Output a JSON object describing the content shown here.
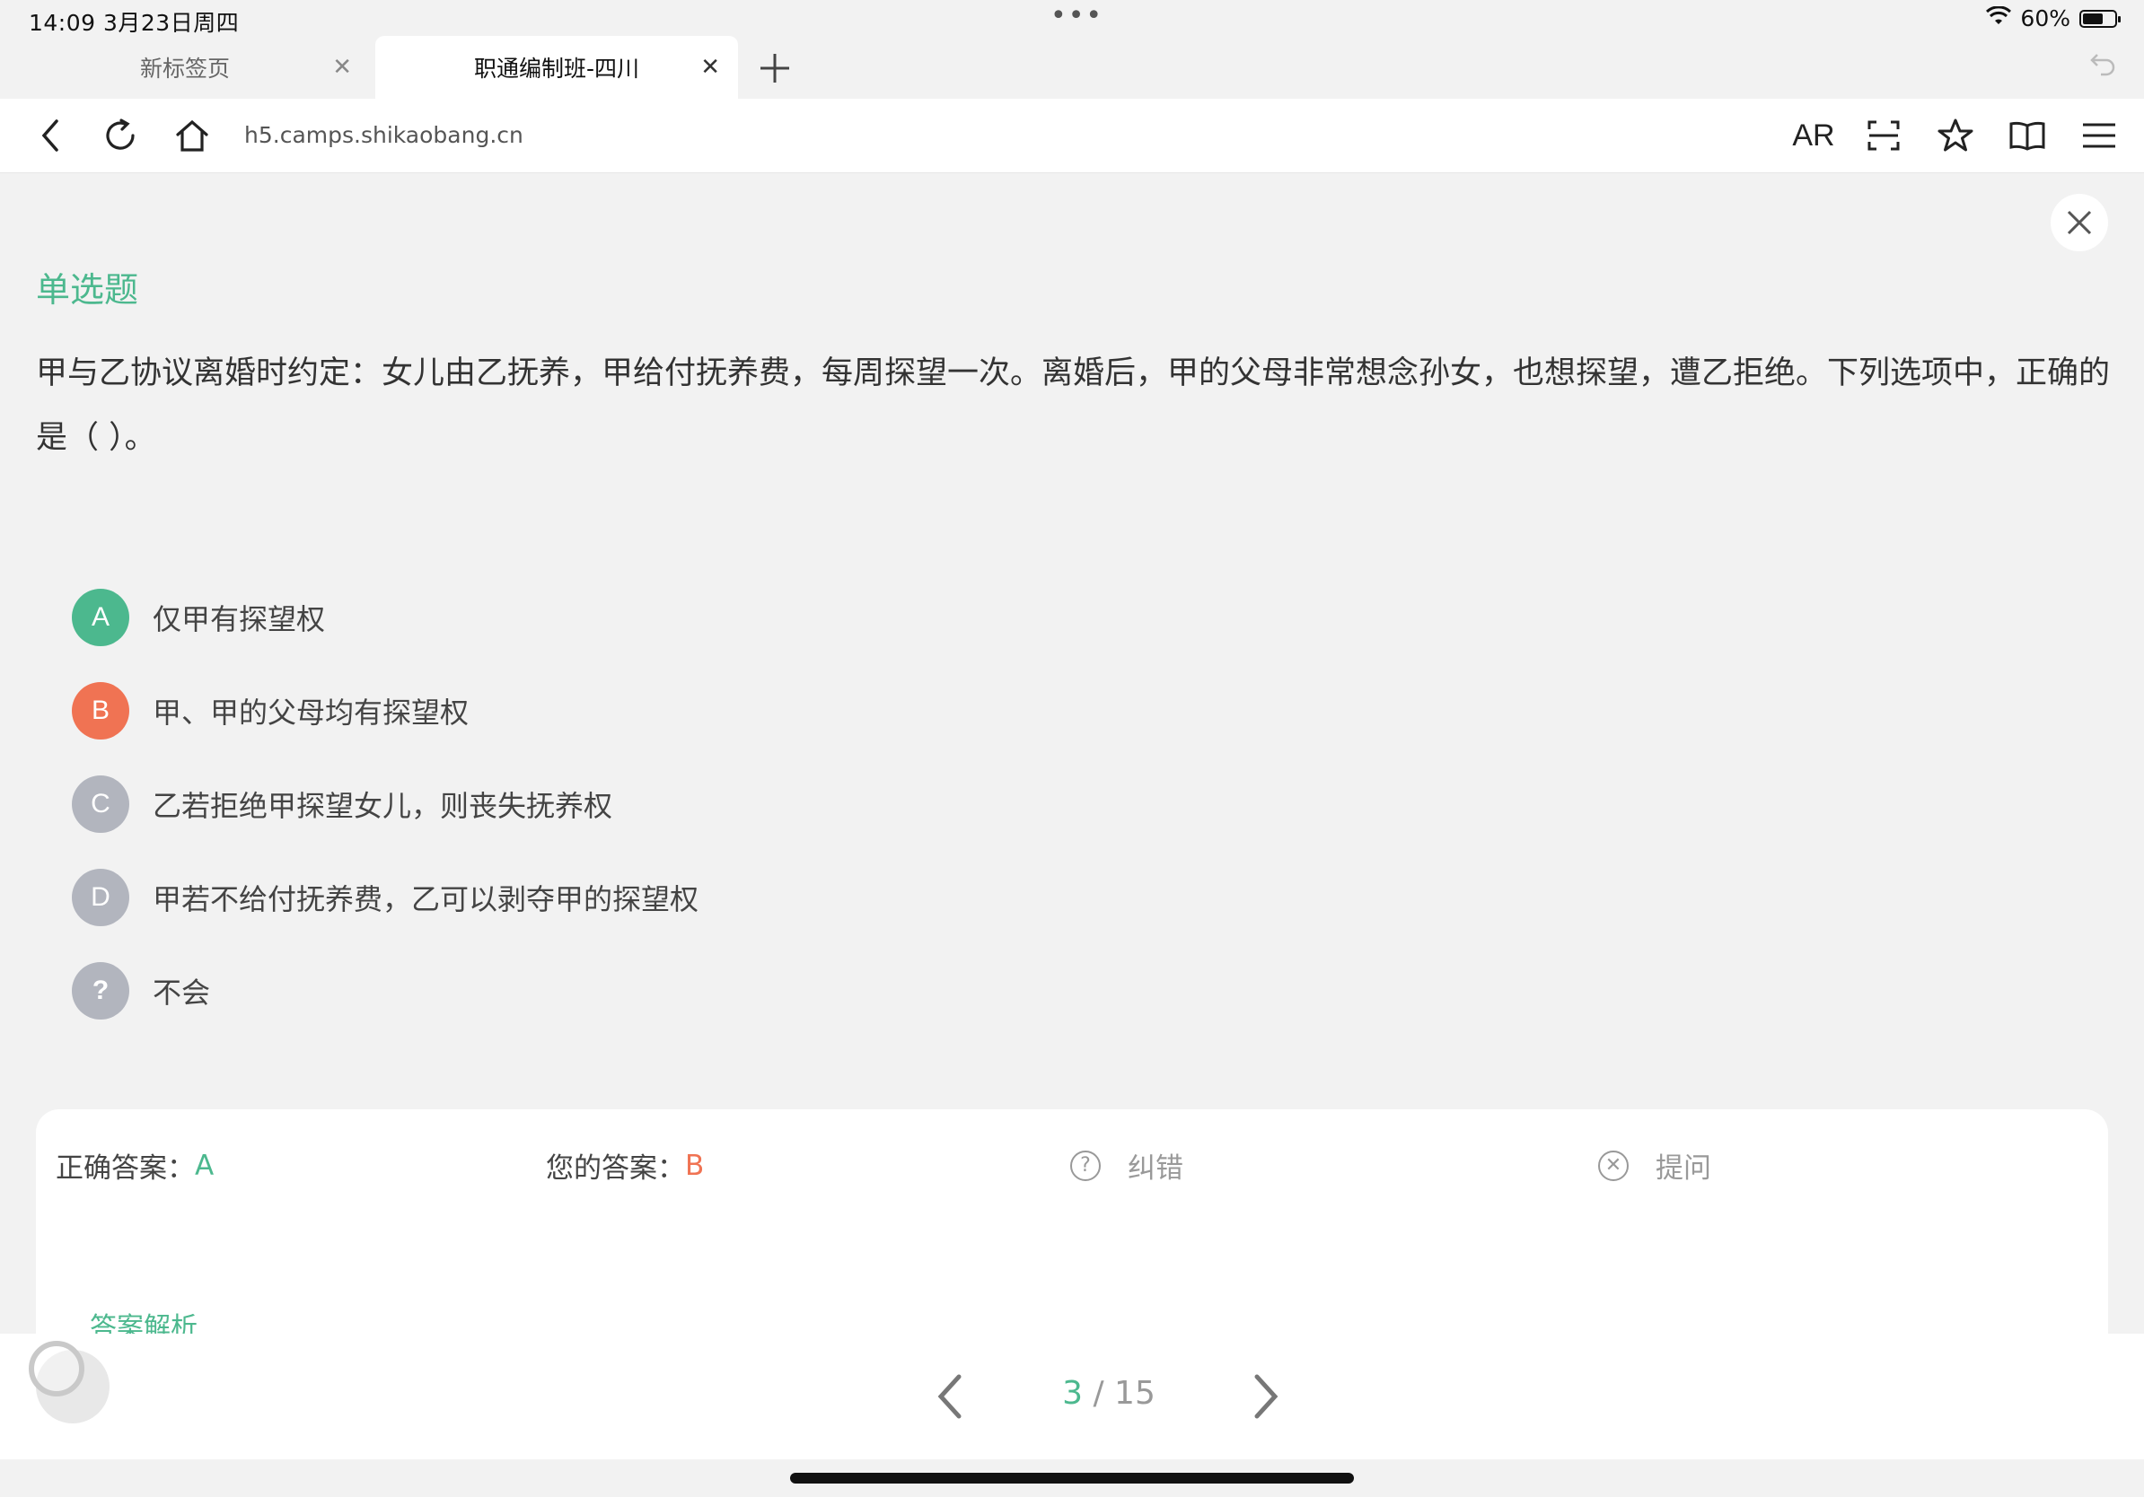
{
  "status": {
    "time": "14:09   3月23日周四",
    "dots": "•••",
    "battery": "60%"
  },
  "tabs": [
    {
      "label": "新标签页",
      "active": false
    },
    {
      "label": "职通编制班-四川",
      "active": true
    }
  ],
  "toolbar": {
    "url": "h5.camps.shikaobang.cn",
    "ar_label": "AR"
  },
  "question": {
    "type": "单选题",
    "text": "甲与乙协议离婚时约定：女儿由乙抚养，甲给付抚养费，每周探望一次。离婚后，甲的父母非常想念孙女，也想探望，遭乙拒绝。下列选项中，正确的是（ ）。",
    "options": [
      {
        "letter": "A",
        "text": "仅甲有探望权",
        "color": "#4cb88e"
      },
      {
        "letter": "B",
        "text": "甲、甲的父母均有探望权",
        "color": "#f07353"
      },
      {
        "letter": "C",
        "text": "乙若拒绝甲探望女儿，则丧失抚养权",
        "color": "#b2b5be"
      },
      {
        "letter": "D",
        "text": "甲若不给付抚养费，乙可以剥夺甲的探望权",
        "color": "#b2b5be"
      },
      {
        "letter": "?",
        "text": "不会",
        "color": "#b2b5be"
      }
    ]
  },
  "answer": {
    "correct_label": "正确答案：",
    "correct_value": "A",
    "yours_label": "您的答案：",
    "yours_value": "B",
    "report_label": "纠错",
    "ask_label": "提问",
    "analysis_title": "答案解析"
  },
  "pager": {
    "current": "3",
    "separator": " / ",
    "total": "15"
  },
  "colors": {
    "accent": "#4cb88e",
    "wrong": "#f07353",
    "neutral": "#b2b5be"
  }
}
